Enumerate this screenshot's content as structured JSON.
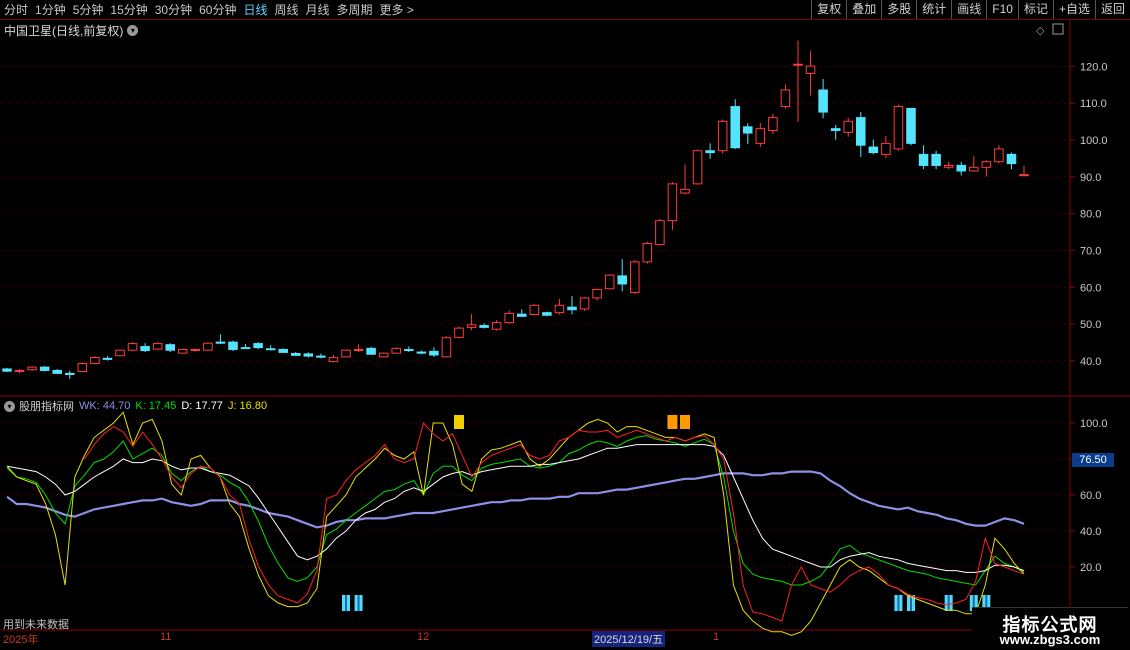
{
  "toolbar": {
    "periods": [
      "分时",
      "1分钟",
      "5分钟",
      "15分钟",
      "30分钟",
      "60分钟",
      "日线",
      "周线",
      "月线",
      "多周期",
      "更多 >"
    ],
    "active_period": "日线",
    "actions": [
      "复权",
      "叠加",
      "多股",
      "统计",
      "画线",
      "F10",
      "标记",
      "+自选",
      "返回"
    ]
  },
  "stock": {
    "title": "中国卫星(日线,前复权)"
  },
  "indicator": {
    "name": "股朋指标网",
    "wk_label": "WK: 44.70",
    "k_label": "K: 17.45",
    "d_label": "D: 17.77",
    "j_label": "J: 16.80",
    "colors": {
      "wk": "#8f8fe6",
      "k": "#00e000",
      "d": "#ffffff",
      "j": "#e6e000",
      "red": "#ff2020"
    }
  },
  "price_axis": {
    "ticks": [
      "120.0",
      "110.0",
      "100.0",
      "90.0",
      "80.0",
      "70.0",
      "60.0",
      "50.0",
      "40.0"
    ]
  },
  "indicator_axis": {
    "ticks": [
      "100.0",
      "80.0",
      "60.0",
      "40.0",
      "20.0"
    ],
    "marker": "76.50"
  },
  "date_axis": {
    "labels": [
      "2025年",
      "11",
      "12",
      "2025/12/19/五",
      "1"
    ],
    "selected": "2025/12/19/五"
  },
  "footer": {
    "future_data_note": "用到未来数据"
  },
  "watermark": {
    "title": "指标公式网",
    "url": "www.zbgs3.com"
  },
  "chart_data": {
    "type": "candlestick",
    "price_ylim": [
      31,
      128
    ],
    "candles": [
      [
        37.8,
        38.1,
        37.0,
        37.2
      ],
      [
        37.2,
        37.8,
        36.6,
        37.4
      ],
      [
        37.6,
        38.6,
        37.3,
        38.3
      ],
      [
        38.3,
        38.6,
        37.1,
        37.4
      ],
      [
        37.4,
        37.8,
        36.4,
        36.6
      ],
      [
        36.6,
        37.3,
        35.1,
        36.3
      ],
      [
        37.1,
        39.6,
        36.9,
        39.3
      ],
      [
        39.3,
        41.3,
        39.1,
        40.9
      ],
      [
        40.7,
        41.3,
        40.1,
        40.4
      ],
      [
        41.4,
        43.1,
        41.2,
        42.9
      ],
      [
        42.9,
        45.1,
        42.6,
        44.7
      ],
      [
        43.9,
        44.8,
        42.4,
        42.8
      ],
      [
        43.2,
        45.1,
        43.0,
        44.7
      ],
      [
        44.4,
        44.8,
        42.4,
        42.9
      ],
      [
        42.1,
        43.4,
        42.0,
        43.1
      ],
      [
        42.9,
        43.3,
        42.5,
        43.1
      ],
      [
        42.9,
        45.1,
        42.7,
        44.8
      ],
      [
        45.1,
        47.2,
        44.6,
        44.8
      ],
      [
        45.1,
        45.5,
        42.7,
        43.1
      ],
      [
        43.6,
        44.6,
        43.2,
        43.4
      ],
      [
        44.7,
        45.1,
        43.2,
        43.6
      ],
      [
        43.3,
        44.3,
        42.8,
        43.1
      ],
      [
        43.1,
        43.4,
        42.3,
        42.3
      ],
      [
        42.0,
        42.4,
        41.4,
        41.5
      ],
      [
        41.9,
        42.3,
        40.9,
        41.3
      ],
      [
        41.3,
        42.0,
        40.7,
        41.0
      ],
      [
        39.8,
        41.6,
        39.6,
        40.9
      ],
      [
        41.1,
        43.1,
        40.9,
        42.9
      ],
      [
        42.9,
        44.5,
        42.4,
        43.1
      ],
      [
        43.4,
        43.8,
        41.7,
        41.8
      ],
      [
        41.1,
        42.3,
        40.9,
        42.1
      ],
      [
        42.1,
        43.7,
        41.9,
        43.4
      ],
      [
        43.1,
        43.9,
        42.4,
        42.9
      ],
      [
        42.4,
        42.8,
        41.8,
        42.1
      ],
      [
        42.6,
        43.7,
        41.1,
        41.6
      ],
      [
        41.1,
        46.7,
        40.9,
        46.3
      ],
      [
        46.4,
        49.3,
        46.1,
        48.9
      ],
      [
        49.1,
        52.7,
        48.3,
        49.8
      ],
      [
        49.6,
        50.2,
        48.8,
        49.1
      ],
      [
        48.6,
        51.1,
        48.2,
        50.4
      ],
      [
        50.4,
        53.7,
        50.1,
        52.9
      ],
      [
        52.7,
        54.0,
        51.9,
        52.1
      ],
      [
        52.6,
        55.4,
        52.4,
        55.1
      ],
      [
        53.1,
        53.4,
        52.1,
        52.4
      ],
      [
        53.1,
        56.8,
        52.6,
        55.1
      ],
      [
        54.6,
        57.6,
        52.6,
        53.9
      ],
      [
        54.1,
        57.4,
        53.6,
        57.1
      ],
      [
        57.1,
        59.6,
        56.4,
        59.4
      ],
      [
        59.6,
        63.6,
        59.4,
        63.3
      ],
      [
        63.1,
        67.6,
        58.9,
        60.9
      ],
      [
        58.6,
        67.4,
        58.1,
        66.9
      ],
      [
        66.9,
        72.4,
        66.4,
        71.9
      ],
      [
        71.6,
        78.6,
        71.4,
        78.1
      ],
      [
        78.1,
        88.6,
        75.6,
        88.1
      ],
      [
        85.6,
        93.4,
        85.2,
        86.6
      ],
      [
        88.1,
        97.4,
        87.9,
        97.1
      ],
      [
        97.1,
        99.1,
        94.9,
        96.6
      ],
      [
        97.1,
        105.6,
        96.4,
        105.1
      ],
      [
        109.1,
        111.1,
        97.6,
        97.9
      ],
      [
        103.6,
        104.6,
        98.9,
        101.9
      ],
      [
        99.1,
        104.6,
        98.1,
        103.1
      ],
      [
        102.6,
        107.1,
        101.6,
        106.1
      ],
      [
        109.1,
        115.1,
        108.6,
        113.6
      ],
      [
        120.6,
        127.0,
        104.9,
        120.6
      ],
      [
        118.1,
        124.1,
        112.1,
        120.1
      ],
      [
        113.6,
        116.6,
        105.9,
        107.6
      ],
      [
        103.1,
        104.1,
        100.1,
        102.6
      ],
      [
        102.1,
        106.1,
        100.9,
        105.1
      ],
      [
        106.1,
        107.6,
        95.4,
        98.6
      ],
      [
        98.1,
        100.1,
        96.1,
        96.6
      ],
      [
        96.1,
        101.1,
        95.1,
        99.1
      ],
      [
        97.6,
        109.6,
        97.1,
        109.1
      ],
      [
        108.6,
        108.6,
        98.6,
        99.1
      ],
      [
        96.1,
        98.6,
        92.1,
        93.1
      ],
      [
        96.1,
        97.1,
        92.1,
        93.1
      ],
      [
        92.6,
        94.1,
        92.1,
        93.1
      ],
      [
        93.1,
        94.1,
        90.4,
        91.6
      ],
      [
        91.6,
        95.6,
        91.4,
        92.6
      ],
      [
        92.6,
        94.6,
        90.1,
        94.1
      ],
      [
        94.1,
        98.6,
        93.6,
        97.6
      ],
      [
        96.1,
        96.6,
        92.1,
        93.6
      ],
      [
        90.6,
        93.1,
        90.1,
        90.6
      ]
    ],
    "series": [
      {
        "name": "WK",
        "values": [
          59,
          55,
          55,
          54,
          53,
          51,
          49,
          48,
          50,
          52,
          53,
          54,
          55,
          56,
          57,
          57,
          58,
          56,
          55,
          54,
          55,
          57,
          57,
          57,
          55,
          54,
          52,
          50,
          49,
          48,
          46,
          44,
          42,
          43,
          45,
          46,
          46,
          47,
          47,
          47,
          48,
          49,
          50,
          50,
          50,
          51,
          52,
          53,
          54,
          55,
          56,
          56,
          57,
          57,
          58,
          58,
          58,
          59,
          59,
          61,
          61,
          61,
          62,
          63,
          63,
          64,
          65,
          66,
          67,
          68,
          69,
          69,
          70,
          71,
          72,
          72,
          72,
          71,
          71,
          72,
          72,
          73,
          73,
          73,
          72,
          68,
          65,
          61,
          58,
          56,
          54,
          53,
          52,
          53,
          51,
          50,
          49,
          47,
          46,
          44,
          43,
          43,
          45,
          47,
          46,
          44
        ]
      },
      {
        "name": "K",
        "values": [
          75,
          70,
          69,
          67,
          60,
          50,
          44,
          65,
          71,
          78,
          80,
          84,
          90,
          80,
          83,
          86,
          82,
          72,
          68,
          73,
          76,
          73,
          71,
          67,
          64,
          56,
          45,
          32,
          22,
          14,
          12,
          14,
          20,
          38,
          41,
          46,
          50,
          54,
          58,
          62,
          63,
          66,
          68,
          60,
          72,
          76,
          76,
          71,
          68,
          75,
          77,
          78,
          79,
          80,
          76,
          75,
          76,
          78,
          83,
          85,
          88,
          90,
          89,
          87,
          90,
          92,
          93,
          91,
          90,
          89,
          87,
          89,
          91,
          88,
          70,
          40,
          22,
          16,
          14,
          13,
          12,
          10,
          10,
          12,
          15,
          22,
          30,
          32,
          28,
          26,
          24,
          22,
          20,
          18,
          17,
          16,
          14,
          13,
          12,
          11,
          10,
          18,
          26,
          22,
          20,
          17
        ]
      },
      {
        "name": "D",
        "values": [
          76,
          75,
          74,
          73,
          70,
          66,
          60,
          62,
          66,
          70,
          73,
          76,
          80,
          78,
          78,
          80,
          79,
          76,
          74,
          75,
          75,
          73,
          72,
          71,
          68,
          65,
          58,
          50,
          42,
          34,
          26,
          24,
          26,
          30,
          36,
          40,
          46,
          50,
          52,
          56,
          58,
          62,
          64,
          62,
          66,
          70,
          72,
          73,
          71,
          73,
          74,
          75,
          76,
          76,
          76,
          77,
          77,
          78,
          79,
          80,
          82,
          84,
          86,
          86,
          87,
          88,
          88,
          88,
          88,
          88,
          88,
          88,
          88,
          87,
          82,
          70,
          58,
          46,
          36,
          30,
          28,
          26,
          24,
          22,
          20,
          20,
          24,
          26,
          27,
          28,
          26,
          25,
          24,
          22,
          21,
          20,
          19,
          18,
          18,
          17,
          17,
          18,
          21,
          21,
          20,
          18
        ]
      },
      {
        "name": "J",
        "values": [
          76,
          70,
          68,
          66,
          55,
          38,
          10,
          70,
          82,
          92,
          96,
          100,
          106,
          88,
          100,
          102,
          90,
          66,
          60,
          80,
          82,
          75,
          70,
          55,
          48,
          30,
          15,
          4,
          0,
          -2,
          -2,
          0,
          8,
          48,
          54,
          60,
          70,
          75,
          80,
          86,
          82,
          80,
          84,
          60,
          100,
          100,
          88,
          66,
          62,
          80,
          85,
          86,
          88,
          90,
          80,
          76,
          80,
          86,
          92,
          96,
          100,
          102,
          100,
          95,
          98,
          98,
          96,
          94,
          92,
          92,
          90,
          92,
          94,
          92,
          60,
          10,
          -4,
          -10,
          -14,
          -16,
          -16,
          -18,
          -16,
          -10,
          0,
          10,
          20,
          24,
          20,
          18,
          14,
          10,
          8,
          4,
          2,
          0,
          -2,
          -4,
          -4,
          -6,
          -6,
          10,
          36,
          30,
          22,
          16
        ]
      },
      {
        "name": "Red",
        "values": [
          null,
          null,
          null,
          null,
          null,
          null,
          null,
          null,
          80,
          88,
          94,
          98,
          95,
          87,
          95,
          88,
          80,
          70,
          64,
          72,
          76,
          75,
          70,
          60,
          55,
          35,
          20,
          10,
          4,
          2,
          0,
          5,
          18,
          58,
          60,
          68,
          74,
          78,
          82,
          88,
          80,
          78,
          80,
          100,
          94,
          90,
          94,
          82,
          70,
          78,
          82,
          84,
          86,
          88,
          82,
          80,
          82,
          90,
          92,
          96,
          95,
          95,
          96,
          92,
          94,
          96,
          94,
          92,
          90,
          92,
          90,
          92,
          93,
          88,
          80,
          50,
          10,
          -5,
          -6,
          -8,
          -10,
          10,
          20,
          10,
          8,
          6,
          10,
          15,
          18,
          20,
          16,
          10,
          8,
          5,
          3,
          2,
          0,
          -1,
          0,
          2,
          12,
          36,
          22,
          20,
          18,
          16
        ]
      }
    ],
    "signals": {
      "yellow_top": [
        36
      ],
      "orange_top": [
        53,
        54
      ],
      "cyan_bottom": [
        27,
        28,
        71,
        72,
        75,
        77,
        78
      ]
    },
    "indicator_ylim": [
      -15,
      115
    ]
  }
}
